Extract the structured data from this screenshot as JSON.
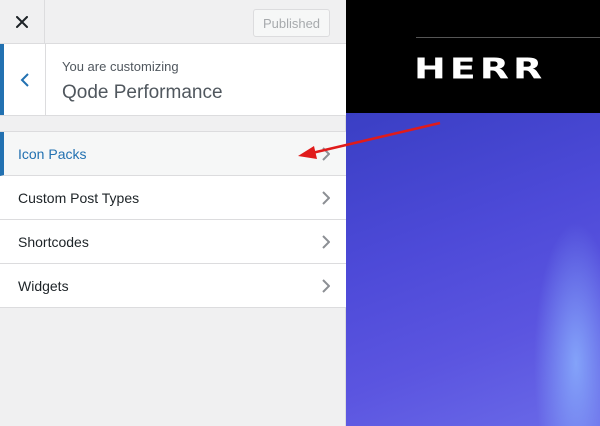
{
  "topbar": {
    "close_icon": "close-icon",
    "publish_label": "Published"
  },
  "info": {
    "back_icon": "chevron-left-icon",
    "subtitle": "You are customizing",
    "title": "Qode Performance"
  },
  "sections": [
    {
      "label": "Icon Packs",
      "active": true
    },
    {
      "label": "Custom Post Types",
      "active": false
    },
    {
      "label": "Shortcodes",
      "active": false
    },
    {
      "label": "Widgets",
      "active": false
    }
  ],
  "preview": {
    "logo_text": "HERR"
  },
  "colors": {
    "accent": "#2271b1",
    "arrow": "#e01b1b",
    "preview_header": "#000000",
    "preview_image": "#4d4ad8"
  }
}
